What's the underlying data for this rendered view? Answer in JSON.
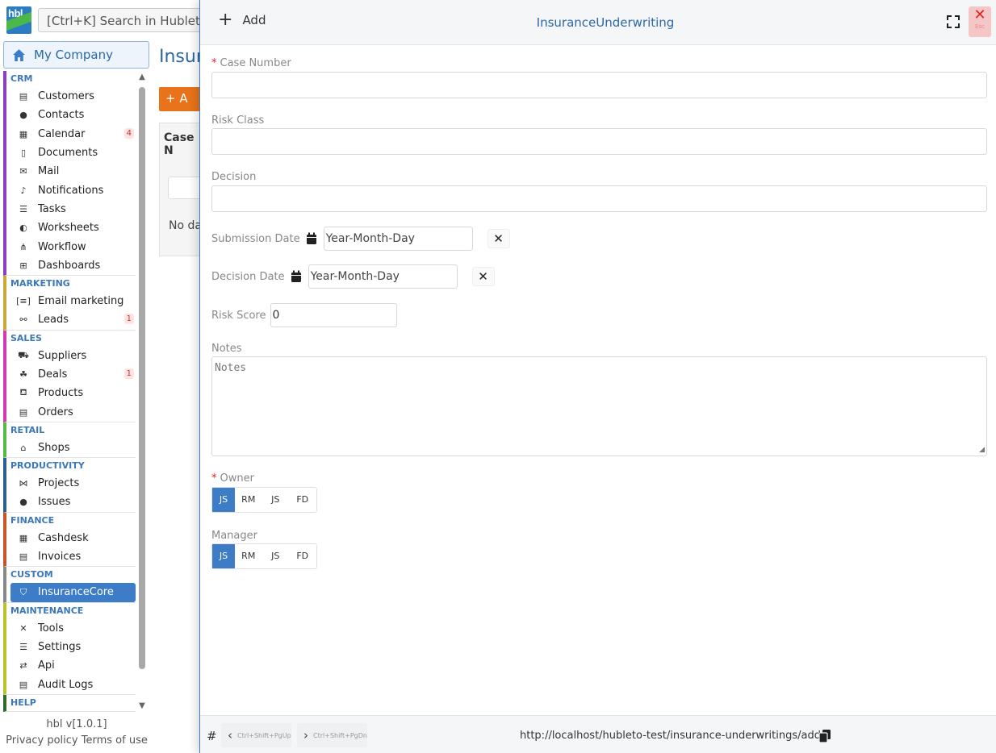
{
  "app": {
    "logo_text": "hbl",
    "search_placeholder": "[Ctrl+K] Search in Hubleto...",
    "company": "My Company",
    "version": "hbl v[1.0.1]",
    "privacy": "Privacy policy",
    "terms": "Terms of use"
  },
  "nav": {
    "groups": [
      {
        "title": "CRM",
        "color": "#8a3fbf",
        "items": [
          {
            "label": "Customers",
            "icon": "id-card-icon",
            "glyph": "▤"
          },
          {
            "label": "Contacts",
            "icon": "user-icon",
            "glyph": "●"
          },
          {
            "label": "Calendar",
            "icon": "calendar-icon",
            "glyph": "▦",
            "badge": "4"
          },
          {
            "label": "Documents",
            "icon": "document-icon",
            "glyph": "▯"
          },
          {
            "label": "Mail",
            "icon": "mail-icon",
            "glyph": "✉"
          },
          {
            "label": "Notifications",
            "icon": "bell-icon",
            "glyph": "♪"
          },
          {
            "label": "Tasks",
            "icon": "tasks-icon",
            "glyph": "☰"
          },
          {
            "label": "Worksheets",
            "icon": "worksheet-icon",
            "glyph": "◐"
          },
          {
            "label": "Workflow",
            "icon": "workflow-icon",
            "glyph": "⋔"
          },
          {
            "label": "Dashboards",
            "icon": "dashboard-icon",
            "glyph": "⊞"
          }
        ]
      },
      {
        "title": "MARKETING",
        "color": "#c9a83a",
        "items": [
          {
            "label": "Email marketing",
            "icon": "email-marketing-icon",
            "glyph": "[≡]"
          },
          {
            "label": "Leads",
            "icon": "leads-icon",
            "glyph": "⚯",
            "badge": "1"
          }
        ]
      },
      {
        "title": "SALES",
        "color": "#d13ab0",
        "items": [
          {
            "label": "Suppliers",
            "icon": "truck-icon",
            "glyph": "⛟"
          },
          {
            "label": "Deals",
            "icon": "handshake-icon",
            "glyph": "☘",
            "badge": "1"
          },
          {
            "label": "Products",
            "icon": "cart-icon",
            "glyph": "⛾"
          },
          {
            "label": "Orders",
            "icon": "orders-icon",
            "glyph": "▤"
          }
        ]
      },
      {
        "title": "RETAIL",
        "color": "#56b847",
        "items": [
          {
            "label": "Shops",
            "icon": "shop-icon",
            "glyph": "⌂"
          }
        ]
      },
      {
        "title": "PRODUCTIVITY",
        "color": "#2b5f8f",
        "items": [
          {
            "label": "Projects",
            "icon": "projects-icon",
            "glyph": "⋈"
          },
          {
            "label": "Issues",
            "icon": "issues-icon",
            "glyph": "●"
          }
        ]
      },
      {
        "title": "FINANCE",
        "color": "#c8552a",
        "items": [
          {
            "label": "Cashdesk",
            "icon": "cashdesk-icon",
            "glyph": "▦"
          },
          {
            "label": "Invoices",
            "icon": "invoice-icon",
            "glyph": "▤"
          }
        ]
      },
      {
        "title": "CUSTOM",
        "color": "#888888",
        "items": [
          {
            "label": "InsuranceCore",
            "icon": "shield-icon",
            "glyph": "⛉",
            "active": true
          }
        ]
      },
      {
        "title": "MAINTENANCE",
        "color": "#b8c42a",
        "items": [
          {
            "label": "Tools",
            "icon": "tools-icon",
            "glyph": "✕"
          },
          {
            "label": "Settings",
            "icon": "sliders-icon",
            "glyph": "☰"
          },
          {
            "label": "Api",
            "icon": "api-icon",
            "glyph": "⇄"
          },
          {
            "label": "Audit Logs",
            "icon": "clipboard-icon",
            "glyph": "▤"
          }
        ]
      },
      {
        "title": "HELP",
        "color": "#2b6b2b",
        "items": []
      }
    ]
  },
  "background_page": {
    "title": "Insur",
    "add_label": "+ A",
    "column": "Case N",
    "no_data": "No da"
  },
  "modal": {
    "add_label": "Add",
    "title": "InsuranceUnderwriting",
    "close_hint": "Esc",
    "fields": {
      "case_number": {
        "label": "Case Number",
        "required": true,
        "value": ""
      },
      "risk_class": {
        "label": "Risk Class",
        "value": ""
      },
      "decision": {
        "label": "Decision",
        "value": ""
      },
      "submission_date": {
        "label": "Submission Date",
        "value": "Year-Month-Day"
      },
      "decision_date": {
        "label": "Decision Date",
        "value": "Year-Month-Day"
      },
      "risk_score": {
        "label": "Risk Score",
        "value": "0"
      },
      "notes": {
        "label": "Notes",
        "placeholder": "Notes"
      },
      "owner": {
        "label": "Owner",
        "required": true,
        "options": [
          "JS",
          "RM",
          "JS",
          "FD"
        ],
        "selected": 0
      },
      "manager": {
        "label": "Manager",
        "options": [
          "JS",
          "RM",
          "JS",
          "FD"
        ],
        "selected": 0
      }
    },
    "footer": {
      "hash": "#",
      "prev_hint": "Ctrl+Shift+PgUp",
      "next_hint": "Ctrl+Shift+PgDn",
      "url": "http://localhost/hubleto-test/insurance-underwritings/add"
    }
  },
  "colors": {
    "accent": "#3d7dc7",
    "danger": "#e02020",
    "primary_orange": "#e8731a"
  }
}
